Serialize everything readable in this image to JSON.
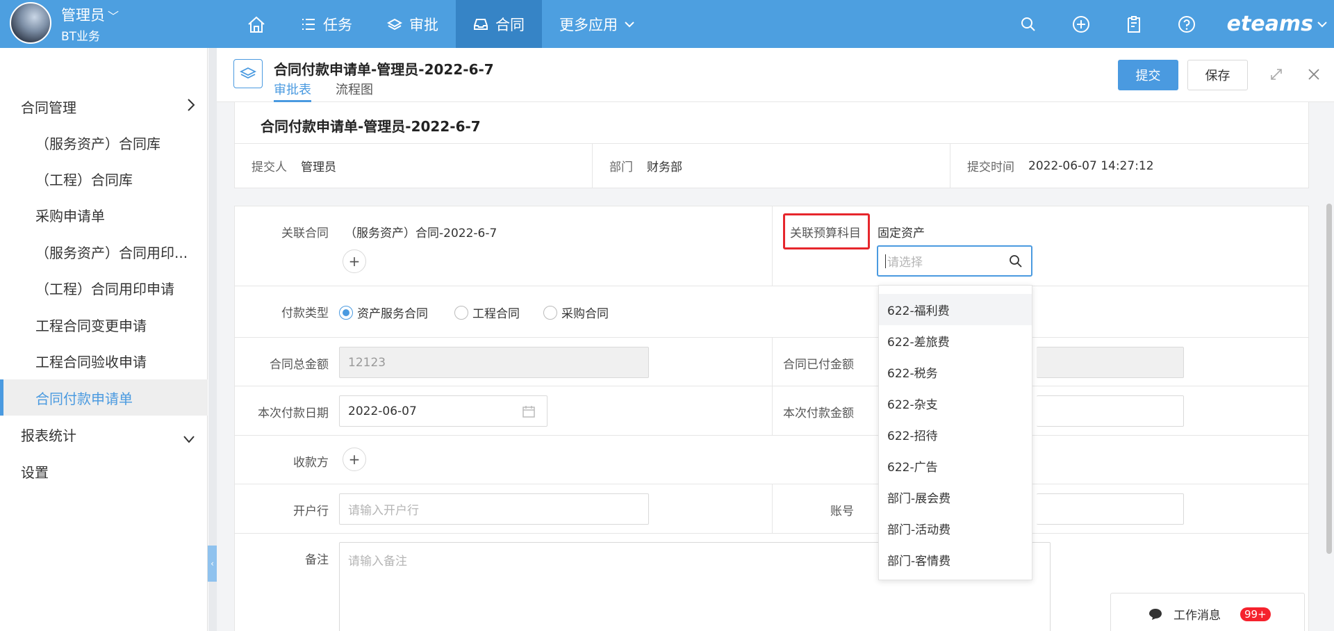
{
  "topbar": {
    "user_name": "管理员",
    "user_org": "BT业务",
    "nav": [
      {
        "label": ""
      },
      {
        "label": "任务"
      },
      {
        "label": "审批"
      },
      {
        "label": "合同"
      },
      {
        "label": "更多应用"
      }
    ],
    "brand": "eteams"
  },
  "sidebar": {
    "items": [
      {
        "label": "合同管理"
      },
      {
        "label": "（服务资产）合同库"
      },
      {
        "label": "（工程）合同库"
      },
      {
        "label": "采购申请单"
      },
      {
        "label": "（服务资产）合同用印..."
      },
      {
        "label": "（工程）合同用印申请"
      },
      {
        "label": "工程合同变更申请"
      },
      {
        "label": "工程合同验收申请"
      },
      {
        "label": "合同付款申请单"
      },
      {
        "label": "报表统计"
      },
      {
        "label": "设置"
      }
    ]
  },
  "header": {
    "title": "合同付款申请单-管理员-2022-6-7",
    "tabs": [
      "审批表",
      "流程图"
    ],
    "submit_label": "提交",
    "save_label": "保存"
  },
  "form": {
    "title": "合同付款申请单-管理员-2022-6-7",
    "submitter_label": "提交人",
    "submitter": "管理员",
    "dept_label": "部门",
    "dept": "财务部",
    "time_label": "提交时间",
    "time": "2022-06-07 14:27:12",
    "related_contract_label": "关联合同",
    "related_contract": "（服务资产）合同-2022-6-7",
    "budget_label": "关联预算科目",
    "budget_value": "固定资产",
    "budget_placeholder": "请选择",
    "pay_type_label": "付款类型",
    "pay_types": [
      "资产服务合同",
      "工程合同",
      "采购合同"
    ],
    "total_label": "合同总金额",
    "total_value": "12123",
    "paid_label": "合同已付金额",
    "pay_date_label": "本次付款日期",
    "pay_date": "2022-06-07",
    "pay_amount_label": "本次付款金额",
    "payee_label": "收款方",
    "bank_label": "开户行",
    "bank_placeholder": "请输入开户行",
    "account_label": "账号",
    "remark_label": "备注",
    "remark_placeholder": "请输入备注"
  },
  "dropdown": {
    "options": [
      "622-福利费",
      "622-差旅费",
      "622-税务",
      "622-杂支",
      "622-招待",
      "622-广告",
      "部门-展会费",
      "部门-活动费",
      "部门-客情费"
    ]
  },
  "messages": {
    "label": "工作消息",
    "badge": "99+"
  }
}
